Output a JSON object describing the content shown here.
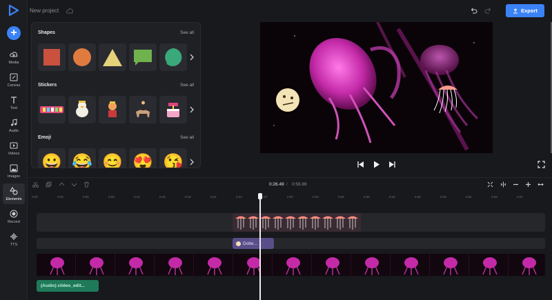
{
  "app": {
    "project_title": "New project",
    "export_label": "Export"
  },
  "rail": {
    "add_label": "+",
    "items": [
      {
        "label": "Media"
      },
      {
        "label": "Canvas"
      },
      {
        "label": "Text"
      },
      {
        "label": "Audio"
      },
      {
        "label": "Videos"
      },
      {
        "label": "Images"
      },
      {
        "label": "Elements"
      },
      {
        "label": "Record"
      },
      {
        "label": "TTS"
      }
    ]
  },
  "panel": {
    "sections": [
      {
        "title": "Shapes",
        "see_all": "See all"
      },
      {
        "title": "Stickers",
        "see_all": "See all"
      },
      {
        "title": "Emoji",
        "see_all": "See all"
      }
    ],
    "emoji": [
      "😀",
      "😂",
      "😊",
      "😍",
      "😘"
    ]
  },
  "timeline": {
    "current_time": "0:26.49",
    "separator": "/",
    "total_time": "0:59.86",
    "ruler_ticks": [
      "0:00",
      "0:03",
      "0:06",
      "0:09",
      "0:12",
      "0:15",
      "0:18",
      "0:21",
      "0:24",
      "0:27",
      "0:30",
      "0:33",
      "0:36",
      "0:39",
      "0:42",
      "0:45",
      "0:48",
      "0:51",
      "0:54",
      "0:57"
    ],
    "dotted_clip_label": "Dotte...",
    "audio_clip_label": "(Audio) clideo_edit..."
  },
  "colors": {
    "accent": "#3b82f6",
    "audio": "#1f7a5a",
    "text_clip": "#5a4e8a"
  }
}
